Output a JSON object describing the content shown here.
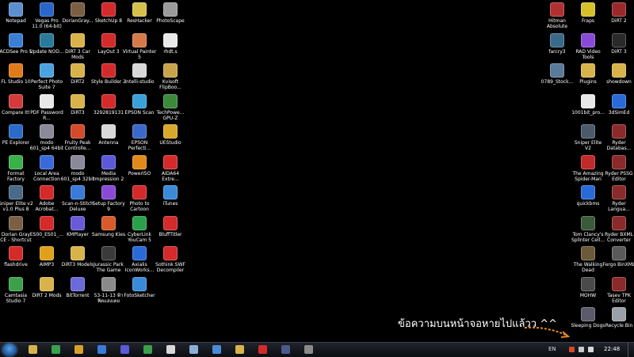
{
  "desktop": {
    "left_icons": [
      {
        "label": "Notepad",
        "color": "#5b8fd0"
      },
      {
        "label": "Vegas Pro 11.0 (64-bit)",
        "color": "#2a66c9"
      },
      {
        "label": "DorianGray...",
        "color": "#7a5f45"
      },
      {
        "label": "SketchUp 8",
        "color": "#d42a2a"
      },
      {
        "label": "ResHacker",
        "color": "#d6c04b"
      },
      {
        "label": "PhotoScape",
        "color": "#9b9b9b"
      },
      {
        "label": "ACDSee Pro 5",
        "color": "#3a7fd4"
      },
      {
        "label": "Update NOD...",
        "color": "#2a7b9b"
      },
      {
        "label": "DiRT 3 Car Mods",
        "color": "#d8b34a"
      },
      {
        "label": "LayOut 3",
        "color": "#d42a2a"
      },
      {
        "label": "Virtual Painter 5",
        "color": "#d67a4a"
      },
      {
        "label": "rhdt.s",
        "color": "#e8e8e8"
      },
      {
        "label": "FL Studio 10",
        "color": "#e07a1a"
      },
      {
        "label": "Perfect Photo Suite 7",
        "color": "#4aa3e0"
      },
      {
        "label": "DiRT2",
        "color": "#d8b34a"
      },
      {
        "label": "Style Builder 2",
        "color": "#d42a2a"
      },
      {
        "label": "Intelli-studio",
        "color": "#d8d8d8"
      },
      {
        "label": "Kvisoft FlipBoo...",
        "color": "#c8a44a"
      },
      {
        "label": "Compare It!",
        "color": "#d43a3a"
      },
      {
        "label": "PDF Password R...",
        "color": "#e8e8e8"
      },
      {
        "label": "DiRT3",
        "color": "#d8b34a"
      },
      {
        "label": "3292819131",
        "color": "#d42a2a"
      },
      {
        "label": "EPSON Scan",
        "color": "#3aa0d8"
      },
      {
        "label": "TechPowe... GPU-Z",
        "color": "#3a8a3a"
      },
      {
        "label": "PE Explorer",
        "color": "#2a6ac9"
      },
      {
        "label": "modo 601_sp4 64bit",
        "color": "#8a8a9a"
      },
      {
        "label": "Fruity Peak Controlle...",
        "color": "#d44a2a"
      },
      {
        "label": "Antenna",
        "color": "#d8d8d8"
      },
      {
        "label": "EPSON Perfecti...",
        "color": "#3a6ac9"
      },
      {
        "label": "UEStudio",
        "color": "#d8a82a"
      },
      {
        "label": "Format Factory",
        "color": "#3ab04a"
      },
      {
        "label": "Local Area Connection",
        "color": "#3a6ad8"
      },
      {
        "label": "modo 601_sp4 32bit",
        "color": "#8a8a9a"
      },
      {
        "label": "Media Impression 2",
        "color": "#5a5ad8"
      },
      {
        "label": "PowerISO",
        "color": "#e08a1a"
      },
      {
        "label": "AIDA64 Extre...",
        "color": "#d42a2a"
      },
      {
        "label": "Sniper Elite v2 v1.0 Plus 8",
        "color": "#4a6a8a"
      },
      {
        "label": "Adobe Acrobat...",
        "color": "#d42a2a"
      },
      {
        "label": "Scan-n-Stitch Deluxe",
        "color": "#3a7ad8"
      },
      {
        "label": "Setup Factory 9",
        "color": "#8a4ad8"
      },
      {
        "label": "Photo to Cartoon",
        "color": "#d42a2a"
      },
      {
        "label": "iTunes",
        "color": "#3a8ad8"
      },
      {
        "label": "Dorian Gray CE - Shortcut",
        "color": "#7a5f45"
      },
      {
        "label": "ES00_ES01_...",
        "color": "#d42a2a"
      },
      {
        "label": "KMPlayer",
        "color": "#6a5ad8"
      },
      {
        "label": "Samsung Kies",
        "color": "#d85a2a"
      },
      {
        "label": "CyberLink YouCam 5",
        "color": "#2aa04a"
      },
      {
        "label": "BluffTitler",
        "color": "#d42a2a"
      },
      {
        "label": "flashdrive",
        "color": "#d42a2a"
      },
      {
        "label": "AIMP3",
        "color": "#e0a01a"
      },
      {
        "label": "DiRT3 Models",
        "color": "#d8b34a"
      },
      {
        "label": "Jurassic Park The Game",
        "color": "#3a3a3a"
      },
      {
        "label": "Axialis IconWorks...",
        "color": "#2a6ad8"
      },
      {
        "label": "Sothink SWF Decompiler",
        "color": "#d42a2a"
      },
      {
        "label": "Camtasia Studio 7",
        "color": "#3aa04a"
      },
      {
        "label": "DiRT 2 Mods",
        "color": "#d8b34a"
      },
      {
        "label": "BitTorrent",
        "color": "#6a6ad8"
      },
      {
        "label": "53-11-13 ฟ้า ฟิดแสงเดย",
        "color": "#8a8a8a"
      },
      {
        "label": "FotoSketcher",
        "color": "#3a8ad8"
      }
    ],
    "right_icons": [
      {
        "label": "Hitman Absolute",
        "color": "#b03030"
      },
      {
        "label": "Fraps",
        "color": "#d8c02a"
      },
      {
        "label": "DiRT 2",
        "color": "#9a2a2a"
      },
      {
        "label": "farcry3",
        "color": "#3a6a8a"
      },
      {
        "label": "RAD Video Tools",
        "color": "#8a4ad8"
      },
      {
        "label": "DiRT 3",
        "color": "#2a2a2a"
      },
      {
        "label": "0789_Stock...",
        "color": "#5a7a9a"
      },
      {
        "label": "Plugins",
        "color": "#d8b34a"
      },
      {
        "label": "showdown",
        "color": "#d8b34a"
      },
      {
        "label": "1001bit_pro...",
        "color": "#e8e8e8"
      },
      {
        "label": "3dSimEd",
        "color": "#2a6ad8"
      },
      {
        "label": "Sniper Elite V2",
        "color": "#4a5a6a"
      },
      {
        "label": "Ryder Databas...",
        "color": "#8a2a2a"
      },
      {
        "label": "The Amazing Spider-Man",
        "color": "#c02a2a"
      },
      {
        "label": "Ryder PSSG Editor",
        "color": "#8a2a2a"
      },
      {
        "label": "quickbms",
        "color": "#2a6ad8"
      },
      {
        "label": "Ryder Langua...",
        "color": "#8a2a2a"
      },
      {
        "label": "Tom Clancy's Splinter Cell...",
        "color": "#3a5a3a"
      },
      {
        "label": "Ryder BXML Converter",
        "color": "#8a2a2a"
      },
      {
        "label": "The Walking Dead",
        "color": "#6a5a3a"
      },
      {
        "label": "Fergo BinXML",
        "color": "#5a5a5a"
      },
      {
        "label": "MOHW",
        "color": "#4a4a4a"
      },
      {
        "label": "Tasev TPK Editor",
        "color": "#8a2a2a"
      },
      {
        "label": "Sleeping Dogs",
        "color": "#5a5a6a"
      },
      {
        "label": "Recycle Bin",
        "color": "#9aa0a8"
      }
    ],
    "overlay_text": "ข้อความบนหน้าจอหายไปแล้วว ^^",
    "arrow_color": "#e08a2a"
  },
  "taskbar": {
    "pinned": [
      {
        "name": "explorer-icon",
        "color": "#d8b34a"
      },
      {
        "name": "users-icon",
        "color": "#3aa04a"
      },
      {
        "name": "chrome-icon",
        "color": "#d8a02a"
      },
      {
        "name": "app-icon-4",
        "color": "#3a7ad8"
      },
      {
        "name": "app-icon-5",
        "color": "#5a5ad8"
      },
      {
        "name": "app-icon-6",
        "color": "#3aa04a"
      },
      {
        "name": "app-icon-7",
        "color": "#d8d8d8"
      },
      {
        "name": "app-icon-8",
        "color": "#8ab0d8"
      },
      {
        "name": "app-icon-9",
        "color": "#4a8ad8"
      },
      {
        "name": "app-icon-10",
        "color": "#d8b34a"
      },
      {
        "name": "app-icon-11",
        "color": "#d42a2a"
      },
      {
        "name": "app-icon-12",
        "color": "#4a5a8a"
      },
      {
        "name": "app-icon-13",
        "color": "#8a8a8a"
      }
    ],
    "language": "EN",
    "clock": "22:48"
  }
}
